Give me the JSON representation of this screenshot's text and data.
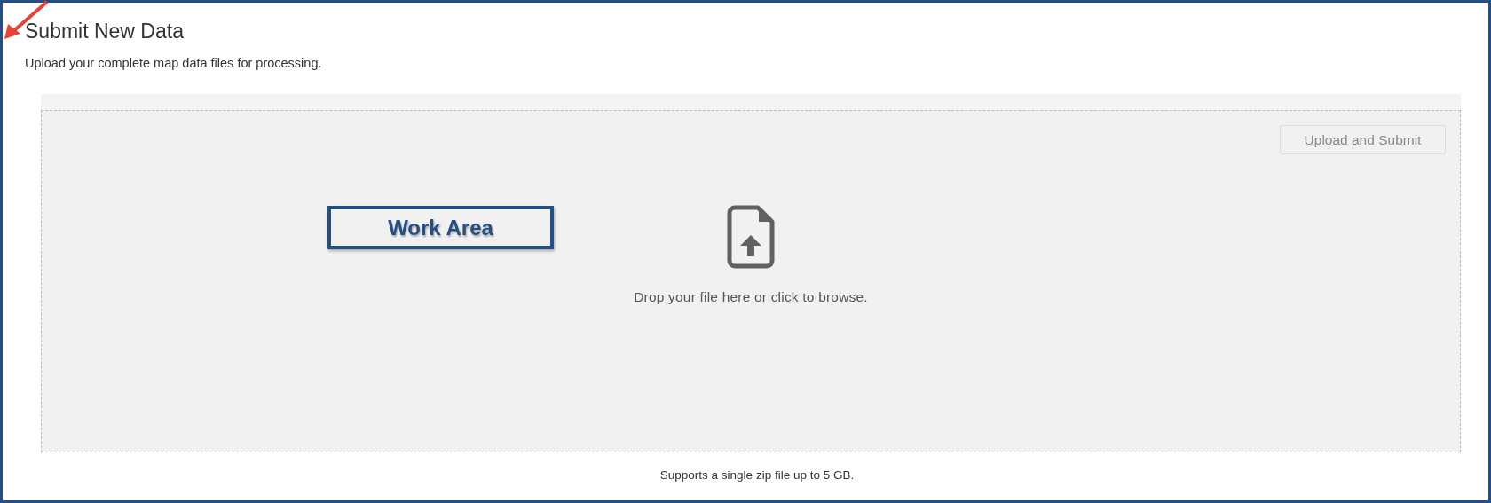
{
  "page": {
    "title": "Submit New Data",
    "subtitle": "Upload your complete map data files for processing."
  },
  "dropzone": {
    "button": {
      "label": "Upload and Submit",
      "disabled": true
    },
    "prompt": "Drop your file here or click to browse."
  },
  "annotation": {
    "label": "Work Area"
  },
  "footer": {
    "note": "Supports a single zip file up to 5 GB."
  }
}
